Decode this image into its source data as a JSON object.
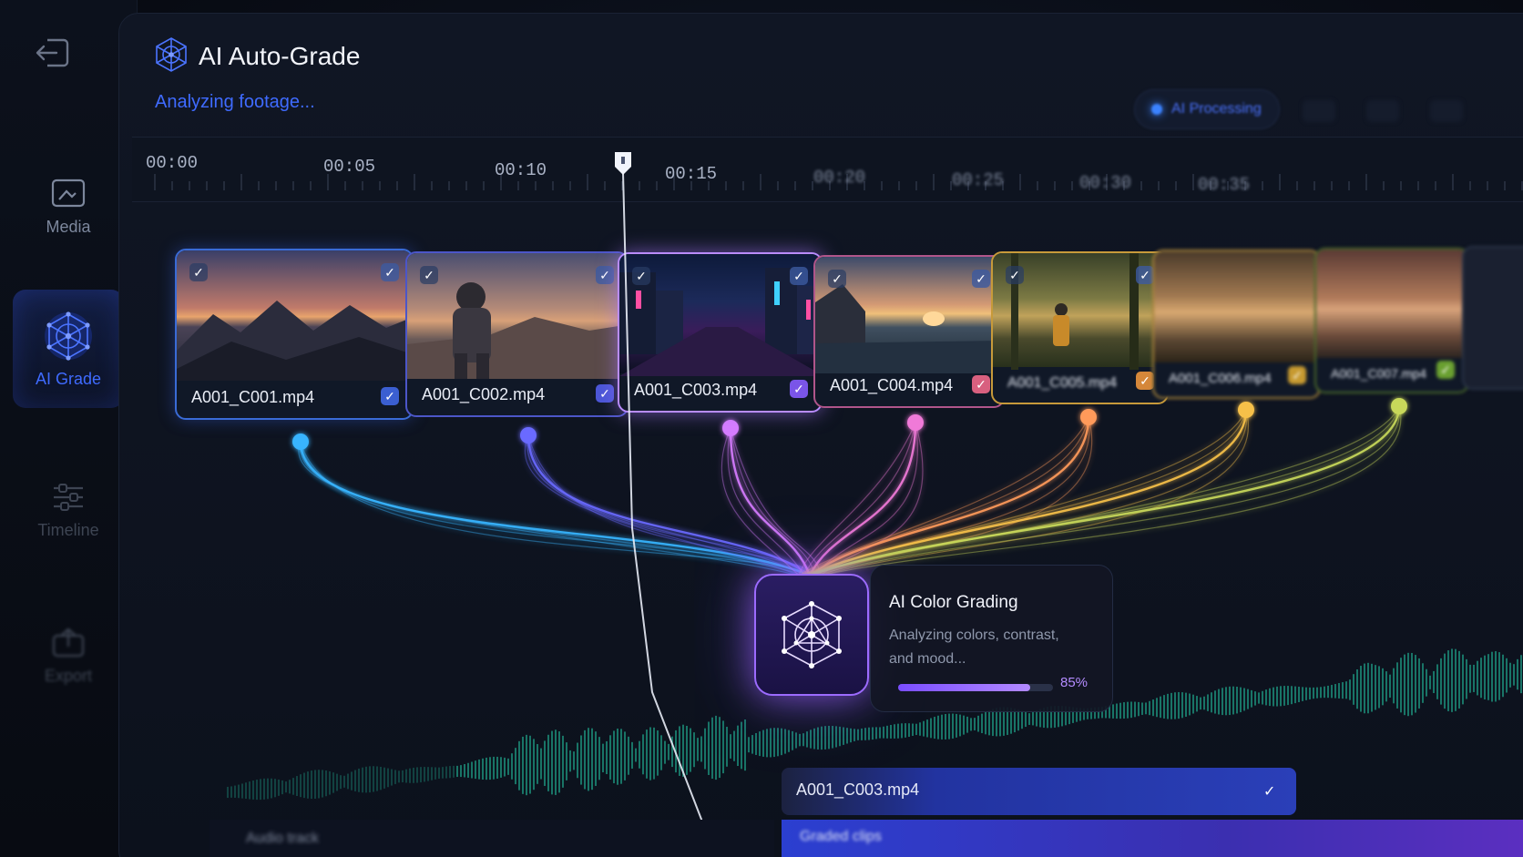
{
  "app": {
    "title": "AI Auto-Grade",
    "subtitle": "Analyzing footage...",
    "status": "AI Processing"
  },
  "sidebar": {
    "items": [
      {
        "label": "Media",
        "icon": "media-icon"
      },
      {
        "label": "AI Grade",
        "icon": "ai-network-icon",
        "active": true
      },
      {
        "label": "Timeline",
        "icon": "timeline-icon"
      },
      {
        "label": "Export",
        "icon": "export-icon"
      }
    ]
  },
  "ruler": {
    "ticks": [
      "00:00",
      "00:05",
      "00:10",
      "00:15",
      "00:20",
      "00:25",
      "00:30",
      "00:35"
    ]
  },
  "clips": [
    {
      "name": "A001_C001.mp4",
      "accent": "#3b82f6"
    },
    {
      "name": "A001_C002.mp4",
      "accent": "#6366f1"
    },
    {
      "name": "A001_C003.mp4",
      "accent": "#c084fc",
      "selected": true
    },
    {
      "name": "A001_C004.mp4",
      "accent": "#f472b6"
    },
    {
      "name": "A001_C005.mp4",
      "accent": "#f59e0b"
    },
    {
      "name": "A001_C006.mp4",
      "accent": "#eab308"
    },
    {
      "name": "A001_C007.mp4",
      "accent": "#84cc16"
    }
  ],
  "ai_card": {
    "title": "AI Color Grading",
    "description": "Analyzing colors, contrast, and mood...",
    "progress": 0.85,
    "progress_label": "85%"
  },
  "timeline": {
    "active_clip": "A001_C003.mp4",
    "secondary_label": "Graded clips",
    "left_label": "Audio track"
  },
  "colors": {
    "accent_blue": "#3f6bff",
    "accent_purple": "#9c6bff",
    "waveform": "#1f9e86"
  }
}
